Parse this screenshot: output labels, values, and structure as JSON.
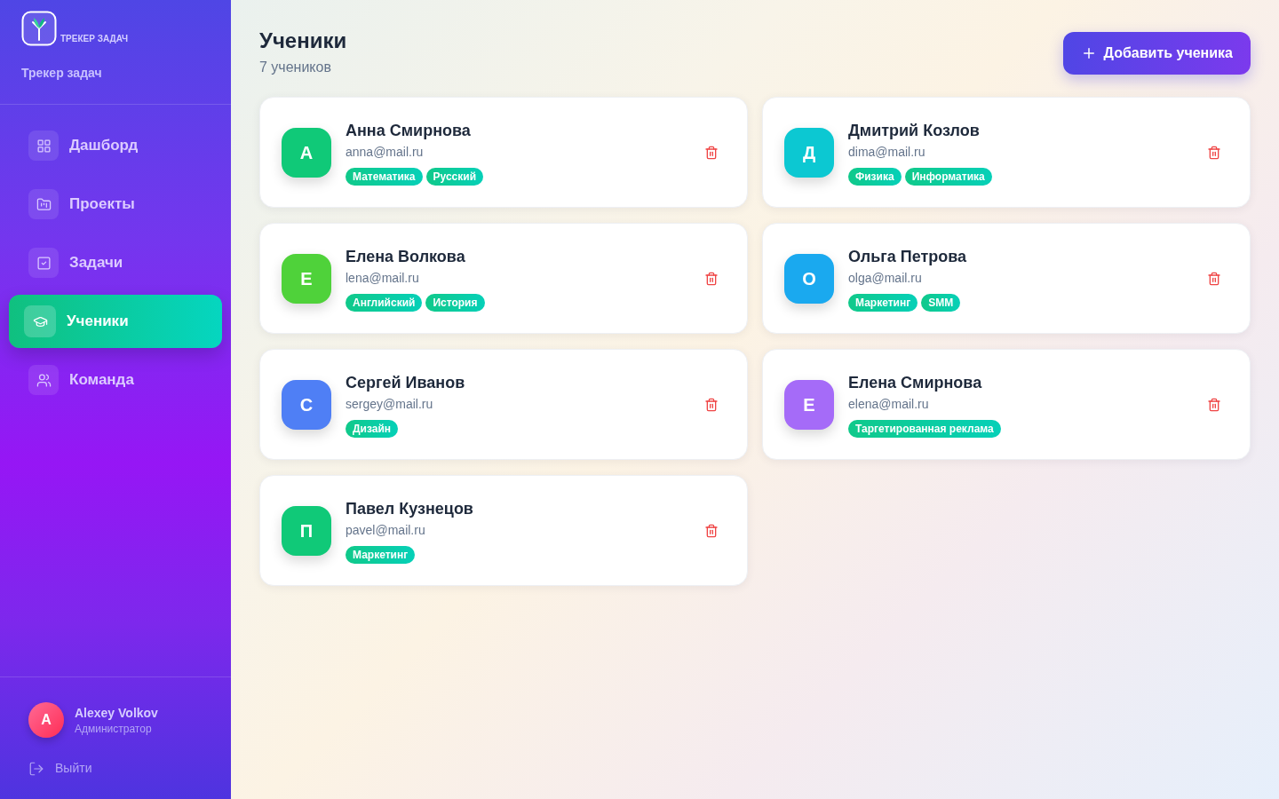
{
  "sidebar": {
    "logo_caption": "ТРЕКЕР ЗАДАЧ",
    "app_name": "Трекер задач",
    "nav": [
      {
        "label": "Дашборд",
        "selected": false
      },
      {
        "label": "Проекты",
        "selected": false
      },
      {
        "label": "Задачи",
        "selected": false
      },
      {
        "label": "Ученики",
        "selected": true
      },
      {
        "label": "Команда",
        "selected": false
      }
    ],
    "user": {
      "initial": "A",
      "name": "Alexey Volkov",
      "role": "Администратор"
    },
    "logout": "Выйти"
  },
  "header": {
    "title": "Ученики",
    "count": "7 учеников",
    "add_button": "Добавить ученика"
  },
  "students": [
    {
      "initial": "А",
      "name": "Анна Смирнова",
      "email": "anna@mail.ru",
      "color": "#10c978",
      "tags": [
        "Математика",
        "Русский"
      ]
    },
    {
      "initial": "Д",
      "name": "Дмитрий Козлов",
      "email": "dima@mail.ru",
      "color": "#0cc8d2",
      "tags": [
        "Физика",
        "Информатика"
      ]
    },
    {
      "initial": "Е",
      "name": "Елена Волкова",
      "email": "lena@mail.ru",
      "color": "#4fd23a",
      "tags": [
        "Английский",
        "История"
      ]
    },
    {
      "initial": "О",
      "name": "Ольга Петрова",
      "email": "olga@mail.ru",
      "color": "#1aa9ef",
      "tags": [
        "Маркетинг",
        "SMM"
      ]
    },
    {
      "initial": "С",
      "name": "Сергей Иванов",
      "email": "sergey@mail.ru",
      "color": "#4f7ff5",
      "tags": [
        "Дизайн"
      ]
    },
    {
      "initial": "Е",
      "name": "Елена Смирнова",
      "email": "elena@mail.ru",
      "color": "#a56bf8",
      "tags": [
        "Таргетированная реклама"
      ]
    },
    {
      "initial": "П",
      "name": "Павел Кузнецов",
      "email": "pavel@mail.ru",
      "color": "#10c978",
      "tags": [
        "Маркетинг"
      ]
    }
  ]
}
